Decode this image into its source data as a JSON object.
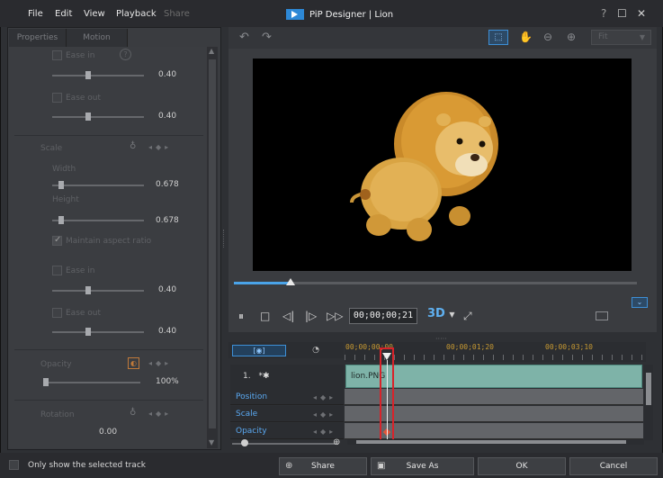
{
  "menu": [
    "File",
    "Edit",
    "View",
    "Playback",
    "Share"
  ],
  "window_title": "PiP Designer | Lion",
  "window_buttons": {
    "help": "?",
    "maximize": "☐",
    "close": "✕"
  },
  "left_tabs": [
    "Properties",
    "Motion"
  ],
  "properties": {
    "ease_in_label": "Ease in",
    "ease_out_label": "Ease out",
    "ease_in_value": "0.40",
    "ease_out_value": "0.40",
    "scale_label": "Scale",
    "width_label": "Width",
    "width_value": "0.678",
    "height_label": "Height",
    "height_value": "0.678",
    "maintain_aspect_label": "Maintain aspect ratio",
    "scale_ease_in_label": "Ease in",
    "scale_ease_in_value": "0.40",
    "scale_ease_out_label": "Ease out",
    "scale_ease_out_value": "0.40",
    "opacity_label": "Opacity",
    "opacity_value": "100%",
    "rotation_label": "Rotation",
    "rotation_value": "0.00"
  },
  "preview_toolbar": {
    "fit_label": "Fit"
  },
  "playback": {
    "timecode": "00;00;00;21",
    "mode_3d": "3D"
  },
  "timeline": {
    "ruler_labels": [
      "00;00;00;00",
      "00;00;01;20",
      "00;00;03;10"
    ],
    "track1_label": "1.",
    "clip_label": "lion.PNG",
    "tracks": [
      "Position",
      "Scale",
      "Opacity"
    ]
  },
  "bottom": {
    "only_selected_label": "Only show the selected track",
    "share_label": "Share",
    "save_as_label": "Save As",
    "ok_label": "OK",
    "cancel_label": "Cancel"
  },
  "colors": {
    "accent": "#4aa3e8",
    "playhead_box": "#d8232a",
    "clip": "#7eb3a8"
  },
  "icons": [
    "undo-icon",
    "redo-icon",
    "select-icon",
    "hand-icon",
    "zoom-out-icon",
    "zoom-in-icon",
    "pause-icon",
    "stop-icon",
    "prev-frame-icon",
    "next-frame-icon",
    "fast-forward-icon",
    "fullscreen-icon",
    "globe-icon",
    "disk-icon"
  ]
}
